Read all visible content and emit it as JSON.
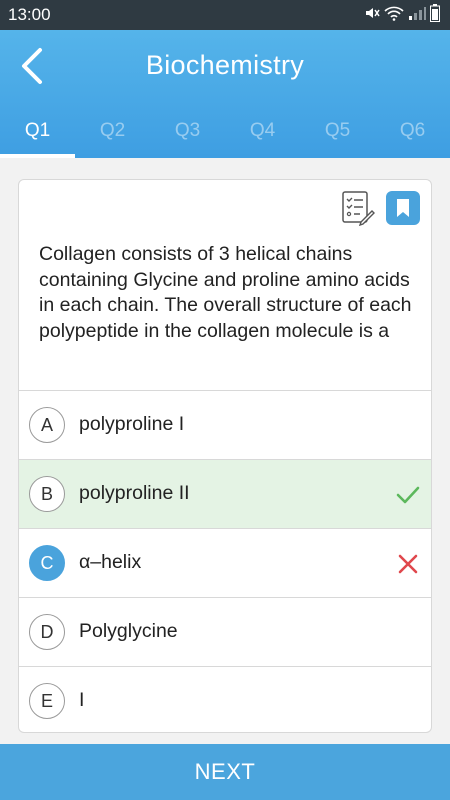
{
  "status_bar": {
    "time": "13:00"
  },
  "header": {
    "title": "Biochemistry"
  },
  "tabs": [
    {
      "label": "Q1"
    },
    {
      "label": "Q2"
    },
    {
      "label": "Q3"
    },
    {
      "label": "Q4"
    },
    {
      "label": "Q5"
    },
    {
      "label": "Q6"
    }
  ],
  "question": {
    "text": "Collagen consists of 3 helical chains containing Glycine and proline amino acids in each chain. The overall structure of each polypeptide in the collagen molecule is a"
  },
  "options": [
    {
      "letter": "A",
      "text": "polyproline I"
    },
    {
      "letter": "B",
      "text": "polyproline II"
    },
    {
      "letter": "C",
      "text": "α–helix"
    },
    {
      "letter": "D",
      "text": "Polyglycine"
    },
    {
      "letter": "E",
      "text": "I"
    }
  ],
  "footer": {
    "next_label": "NEXT"
  },
  "colors": {
    "accent": "#4aa3dc",
    "correct_bg": "#e4f3e4",
    "correct_mark": "#5cb85c",
    "wrong_mark": "#e0474c"
  },
  "icons": {
    "back": "chevron-left-icon",
    "notes": "checklist-pencil-icon",
    "bookmark": "bookmark-icon",
    "correct": "check-icon",
    "wrong": "cross-icon"
  }
}
